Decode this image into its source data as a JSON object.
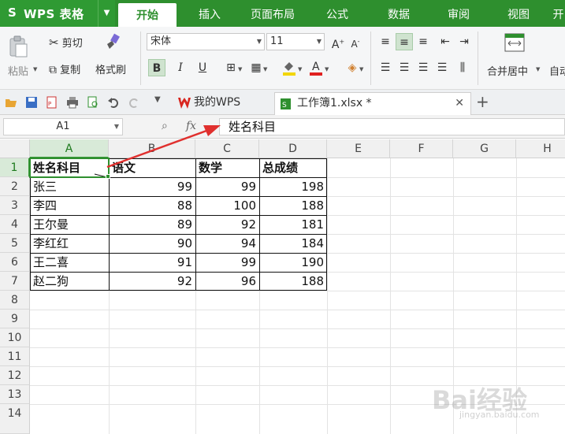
{
  "app": {
    "logo": "S",
    "title": "WPS 表格"
  },
  "menu": {
    "tabs": [
      "开始",
      "插入",
      "页面布局",
      "公式",
      "数据",
      "审阅",
      "视图",
      "开"
    ],
    "active": "开始"
  },
  "ribbon": {
    "paste_label": "粘贴",
    "cut_label": "剪切",
    "copy_label": "复制",
    "format_painter_label": "格式刷",
    "font_name": "宋体",
    "font_size": "11",
    "bold": "B",
    "italic": "I",
    "underline": "U",
    "merge_center_label": "合并居中",
    "auto_wrap_label": "自动"
  },
  "quick_access": {
    "tabs": [
      {
        "label": "我的WPS"
      },
      {
        "label": "工作簿1.xlsx *",
        "active": true
      }
    ],
    "add_tab": "+"
  },
  "formula_bar": {
    "name_box": "A1",
    "fx_label": "fx",
    "value": "姓名科目"
  },
  "sheet": {
    "columns": [
      "A",
      "B",
      "C",
      "D",
      "E",
      "F",
      "G",
      "H"
    ],
    "rows": [
      "1",
      "2",
      "3",
      "4",
      "5",
      "6",
      "7",
      "8",
      "9",
      "10",
      "11",
      "12",
      "13",
      "14"
    ],
    "selected_cell": "A1",
    "header": [
      "姓名科目",
      "语文",
      "数学",
      "总成绩"
    ],
    "data": [
      [
        "张三",
        "99",
        "99",
        "198"
      ],
      [
        "李四",
        "88",
        "100",
        "188"
      ],
      [
        "王尔曼",
        "89",
        "92",
        "181"
      ],
      [
        "李红红",
        "90",
        "94",
        "184"
      ],
      [
        "王二喜",
        "91",
        "99",
        "190"
      ],
      [
        "赵二狗",
        "92",
        "96",
        "188"
      ]
    ]
  },
  "watermark": {
    "text": "Bai经验",
    "sub": "jingyan.baidu.com"
  },
  "colors": {
    "brand": "#2e8f2e",
    "accent": "#2f9a33",
    "arrow": "#e0302e"
  }
}
